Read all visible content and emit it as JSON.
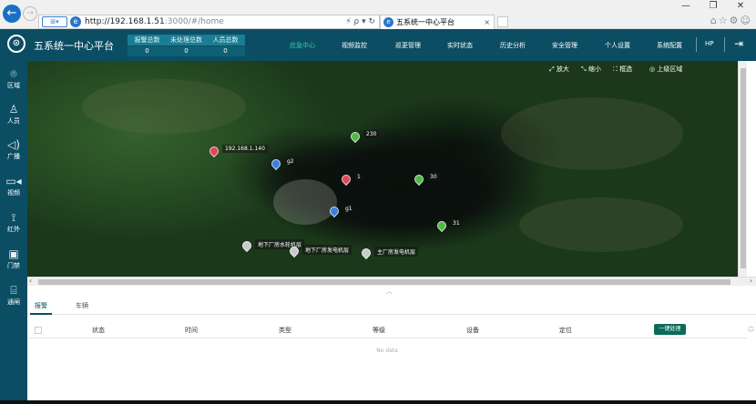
{
  "browser": {
    "url_host": "http://192.168.1.51",
    "url_rest": ":3000/#/home",
    "addr_tools": "⚡ ρ ▾ ↻",
    "tab_title": "五系统一中心平台",
    "tab_close": "×",
    "win_min": "—",
    "win_max": "❐",
    "win_close": "✕",
    "right_tools": "⌂☆⚙☺"
  },
  "app": {
    "title": "五系统一中心平台",
    "stats": [
      {
        "label": "报警总数",
        "value": "0"
      },
      {
        "label": "未处理总数",
        "value": "0"
      },
      {
        "label": "人员总数",
        "value": "0"
      }
    ],
    "menu": [
      "应急中心",
      "视频监控",
      "巡更管理",
      "实时状态",
      "历史分析",
      "安全管理",
      "个人设置",
      "系统配置"
    ],
    "active_menu": "应急中心",
    "user": "HP",
    "accent_color": "#0b4e63",
    "active_color": "#35d3a0"
  },
  "sidebar": [
    {
      "label": "区域",
      "icon": "area-icon"
    },
    {
      "label": "人员",
      "icon": "person-icon"
    },
    {
      "label": "广播",
      "icon": "broadcast-icon"
    },
    {
      "label": "视频",
      "icon": "video-icon"
    },
    {
      "label": "红外",
      "icon": "infrared-icon"
    },
    {
      "label": "门禁",
      "icon": "door-access-icon"
    },
    {
      "label": "通闸",
      "icon": "gate-icon"
    }
  ],
  "map": {
    "tools": [
      "放大",
      "缩小",
      "框选",
      "上级区域"
    ],
    "markers": [
      {
        "label": "192.168.1.140",
        "color": "red"
      },
      {
        "label": "230",
        "color": "green"
      },
      {
        "label": "g2",
        "color": "blue"
      },
      {
        "label": "1",
        "color": "red"
      },
      {
        "label": "30",
        "color": "green"
      },
      {
        "label": "g1",
        "color": "blue"
      },
      {
        "label": "31",
        "color": "green"
      },
      {
        "label": "地下厂房水轮机层",
        "color": "gray"
      },
      {
        "label": "地下厂房发电机层",
        "color": "gray"
      },
      {
        "label": "主厂房发电机层",
        "color": "gray"
      }
    ]
  },
  "panel": {
    "tabs": [
      "报警",
      "车辆"
    ],
    "active_tab": "报警",
    "columns": [
      "状态",
      "时间",
      "类型",
      "等级",
      "设备",
      "定位"
    ],
    "action_button": "一键处理",
    "empty_text": "No data"
  }
}
